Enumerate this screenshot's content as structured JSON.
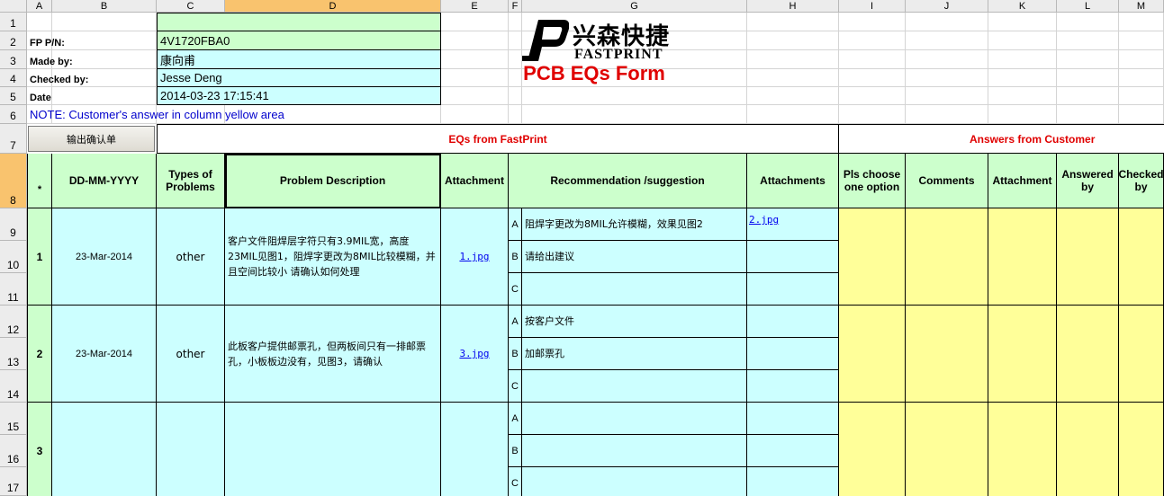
{
  "column_headers": [
    "A",
    "B",
    "C",
    "D",
    "E",
    "F",
    "G",
    "H",
    "I",
    "J",
    "K",
    "L",
    "M"
  ],
  "row_headers": [
    "1",
    "2",
    "3",
    "4",
    "5",
    "6",
    "7",
    "8",
    "9",
    "10",
    "11",
    "12",
    "13",
    "14",
    "15",
    "16",
    "17"
  ],
  "info": {
    "fp_pn_label": "FP P/N:",
    "fp_pn_value": "4V1720FBA0",
    "made_by_label": "Made by:",
    "made_by_value": "康向甫",
    "checked_by_label": "Checked by:",
    "checked_by_value": "Jesse Deng",
    "date_label": "Date",
    "date_value": "2014-03-23 17:15:41",
    "note": "NOTE: Customer's  answer in column yellow area"
  },
  "logo": {
    "chinese": "兴森快捷",
    "english": "FASTPRINT"
  },
  "form_title": "PCB EQs Form",
  "export_button_label": "输出确认单",
  "section_eqs": "EQs from FastPrint",
  "section_answers": "Answers from Customer",
  "table_headers": {
    "index": "*",
    "date": "DD-MM-YYYY",
    "types": "Types of Problems",
    "problem": "Problem Description",
    "attachment": "Attachment",
    "recommendation": "Recommendation /suggestion",
    "attachments": "Attachments",
    "choose": "Pls choose one option",
    "comments": "Comments",
    "cust_attachment": "Attachment",
    "answered_by": "Answered by",
    "checked_by": "Checked by"
  },
  "eqs": [
    {
      "index": "1",
      "date": "23-Mar-2014",
      "type": "other",
      "problem": "客户文件阻焊层字符只有3.9MIL宽，高度23MIL见图1，阻焊字更改为8MIL比较模糊，并且空间比较小 请确认如何处理",
      "attachment": "1.jpg",
      "options": [
        {
          "letter": "A",
          "text": "阻焊字更改为8MIL允许模糊，效果见图2",
          "attachment": "2.jpg"
        },
        {
          "letter": "B",
          "text": "请给出建议",
          "attachment": ""
        },
        {
          "letter": "C",
          "text": "",
          "attachment": ""
        }
      ]
    },
    {
      "index": "2",
      "date": "23-Mar-2014",
      "type": "other",
      "problem": "此板客户提供邮票孔，但两板间只有一排邮票孔，小板板边没有，见图3，请确认",
      "attachment": "3.jpg",
      "options": [
        {
          "letter": "A",
          "text": "按客户文件",
          "attachment": ""
        },
        {
          "letter": "B",
          "text": "加邮票孔",
          "attachment": ""
        },
        {
          "letter": "C",
          "text": "",
          "attachment": ""
        }
      ]
    },
    {
      "index": "3",
      "date": "",
      "type": "",
      "problem": "",
      "attachment": "",
      "options": [
        {
          "letter": "A",
          "text": "",
          "attachment": ""
        },
        {
          "letter": "B",
          "text": "",
          "attachment": ""
        },
        {
          "letter": "C",
          "text": "",
          "attachment": ""
        }
      ]
    }
  ],
  "colors": {
    "green": "#ccffcc",
    "cyan": "#ccffff",
    "yellow": "#ffff99",
    "red": "#e00000",
    "selected_header": "#f9c36e"
  }
}
